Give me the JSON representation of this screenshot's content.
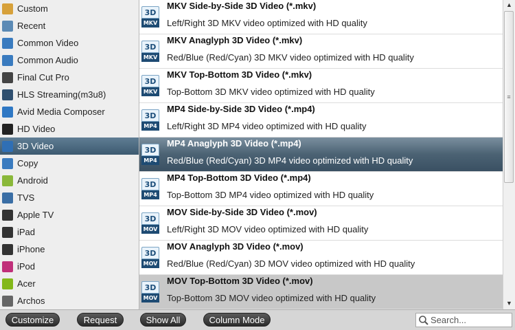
{
  "sidebar": {
    "items": [
      {
        "label": "Custom",
        "icon": "folder-icon",
        "color": "#d7a13a"
      },
      {
        "label": "Recent",
        "icon": "calendar-icon",
        "color": "#5b8ab5"
      },
      {
        "label": "Common Video",
        "icon": "video-icon",
        "color": "#3a7bbf"
      },
      {
        "label": "Common Audio",
        "icon": "music-icon",
        "color": "#3a7bbf"
      },
      {
        "label": "Final Cut Pro",
        "icon": "clapper-icon",
        "color": "#444444"
      },
      {
        "label": "HLS Streaming(m3u8)",
        "icon": "m3u8-icon",
        "color": "#2f4f6f"
      },
      {
        "label": "Avid Media Composer",
        "icon": "avid-icon",
        "color": "#2f78c4"
      },
      {
        "label": "HD Video",
        "icon": "hd-icon",
        "color": "#222222"
      },
      {
        "label": "3D Video",
        "icon": "3d-icon",
        "color": "#2f6fb5"
      },
      {
        "label": "Copy",
        "icon": "copy-icon",
        "color": "#3a7bbf"
      },
      {
        "label": "Android",
        "icon": "android-icon",
        "color": "#8ab83a"
      },
      {
        "label": "TVS",
        "icon": "tv-icon",
        "color": "#3a6ea5"
      },
      {
        "label": "Apple TV",
        "icon": "appletv-icon",
        "color": "#333333"
      },
      {
        "label": "iPad",
        "icon": "ipad-icon",
        "color": "#333333"
      },
      {
        "label": "iPhone",
        "icon": "iphone-icon",
        "color": "#333333"
      },
      {
        "label": "iPod",
        "icon": "ipod-icon",
        "color": "#c0307a"
      },
      {
        "label": "Acer",
        "icon": "acer-icon",
        "color": "#83b81a"
      },
      {
        "label": "Archos",
        "icon": "archos-icon",
        "color": "#666666"
      }
    ],
    "selected_index": 8
  },
  "formats": [
    {
      "title": "MKV Side-by-Side 3D Video (*.mkv)",
      "desc": "Left/Right 3D MKV video optimized with HD quality",
      "badge": "MKV"
    },
    {
      "title": "MKV Anaglyph 3D Video (*.mkv)",
      "desc": "Red/Blue (Red/Cyan) 3D MKV video optimized with HD quality",
      "badge": "MKV"
    },
    {
      "title": "MKV Top-Bottom 3D Video (*.mkv)",
      "desc": "Top-Bottom 3D MKV video optimized with HD quality",
      "badge": "MKV"
    },
    {
      "title": "MP4 Side-by-Side 3D Video (*.mp4)",
      "desc": "Left/Right 3D MP4 video optimized with HD quality",
      "badge": "MP4"
    },
    {
      "title": "MP4 Anaglyph 3D Video (*.mp4)",
      "desc": "Red/Blue (Red/Cyan) 3D MP4 video optimized with HD quality",
      "badge": "MP4"
    },
    {
      "title": "MP4 Top-Bottom 3D Video (*.mp4)",
      "desc": "Top-Bottom 3D MP4 video optimized with HD quality",
      "badge": "MP4"
    },
    {
      "title": "MOV Side-by-Side 3D Video (*.mov)",
      "desc": "Left/Right 3D MOV video optimized with HD quality",
      "badge": "MOV"
    },
    {
      "title": "MOV Anaglyph 3D Video (*.mov)",
      "desc": "Red/Blue (Red/Cyan) 3D MOV video optimized with HD quality",
      "badge": "MOV"
    },
    {
      "title": "MOV Top-Bottom 3D Video (*.mov)",
      "desc": "Top-Bottom 3D MOV video optimized with HD quality",
      "badge": "MOV"
    }
  ],
  "format_icon_top": "3D",
  "selected_format_index": 4,
  "hover_format_index": 8,
  "toolbar": {
    "customize_label": "Customize",
    "request_label": "Request",
    "show_all_label": "Show All",
    "column_mode_label": "Column Mode"
  },
  "search": {
    "placeholder": "Search...",
    "value": ""
  },
  "colors": {
    "selection": "#4b6273",
    "button": "#2b2b2b"
  }
}
